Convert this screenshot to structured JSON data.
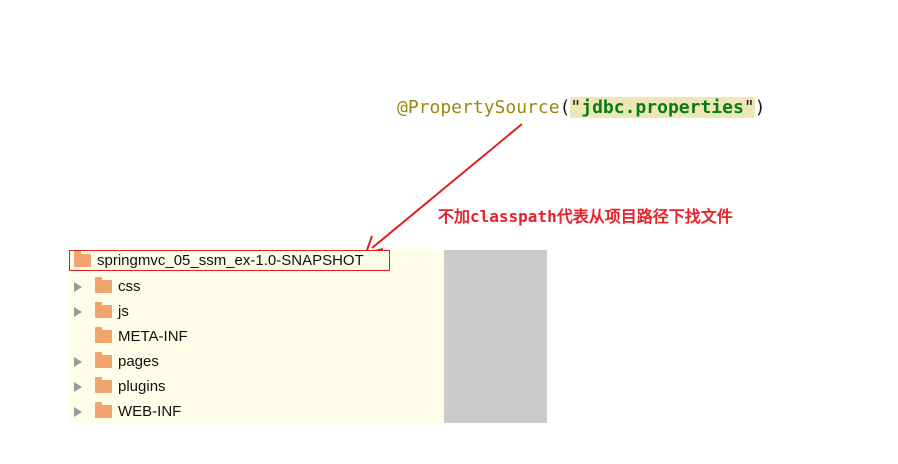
{
  "code": {
    "annotation": "@PropertySource",
    "open_paren": "(",
    "quote_open": "\"",
    "string_value": "jdbc.properties",
    "quote_close": "\"",
    "close_paren": ")"
  },
  "note": {
    "text": "不加classpath代表从项目路径下找文件",
    "color": "#e8202a"
  },
  "tree": {
    "root": {
      "label": "springmvc_05_ssm_ex-1.0-SNAPSHOT",
      "icon": "folder-icon"
    },
    "items": [
      {
        "label": "css",
        "icon": "folder-icon",
        "expandable": true
      },
      {
        "label": "js",
        "icon": "folder-icon",
        "expandable": true
      },
      {
        "label": "META-INF",
        "icon": "folder-icon",
        "expandable": false
      },
      {
        "label": "pages",
        "icon": "folder-icon",
        "expandable": true
      },
      {
        "label": "plugins",
        "icon": "folder-icon",
        "expandable": true
      },
      {
        "label": "WEB-INF",
        "icon": "folder-icon",
        "expandable": true
      }
    ]
  },
  "colors": {
    "annotation": "#9e880d",
    "string": "#067d17",
    "string_highlight": "#efe6b5",
    "tree_background": "#fefee8",
    "folder": "#f0a46e",
    "highlight_border": "#e02020"
  }
}
